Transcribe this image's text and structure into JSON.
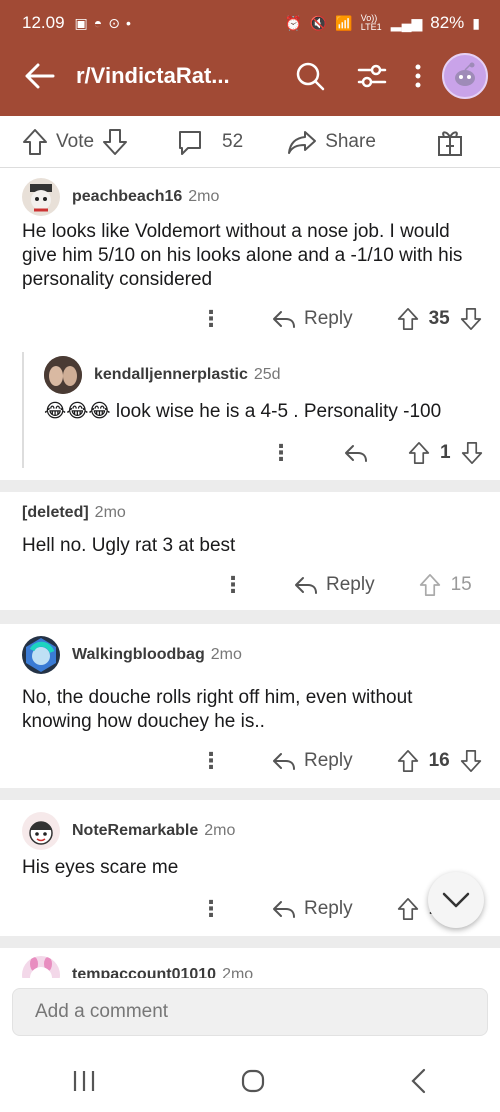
{
  "status_bar": {
    "time": "12.09",
    "network": "Vo)) LTE1",
    "battery": "82%"
  },
  "header": {
    "title": "r/VindictaRat...",
    "brand_color": "#a14a35"
  },
  "post_actions": {
    "vote_label": "Vote",
    "comment_count": "52",
    "share_label": "Share"
  },
  "comments": [
    {
      "user": "peachbeach16",
      "age": "2mo",
      "text": "He looks like Voldemort without a nose job. I would give him 5/10 on his looks alone and a -1/10 with his personality considered",
      "reply_label": "Reply",
      "score": "35"
    },
    {
      "user": "kendalljennerplastic",
      "age": "25d",
      "text": "😂😂😂 look wise he is a 4-5 . Personality -100",
      "score": "1"
    },
    {
      "user": "[deleted]",
      "age": "2mo",
      "text": "Hell no. Ugly rat 3 at best",
      "reply_label": "Reply",
      "score": "15"
    },
    {
      "user": "Walkingbloodbag",
      "age": "2mo",
      "text": "No, the douche rolls right off him, even without knowing how douchey he is..",
      "reply_label": "Reply",
      "score": "16"
    },
    {
      "user": "NoteRemarkable",
      "age": "2mo",
      "text": "His eyes scare me",
      "reply_label": "Reply",
      "score": "1"
    },
    {
      "user": "tempaccount01010",
      "age": "2mo"
    }
  ],
  "composer": {
    "placeholder": "Add a comment"
  }
}
